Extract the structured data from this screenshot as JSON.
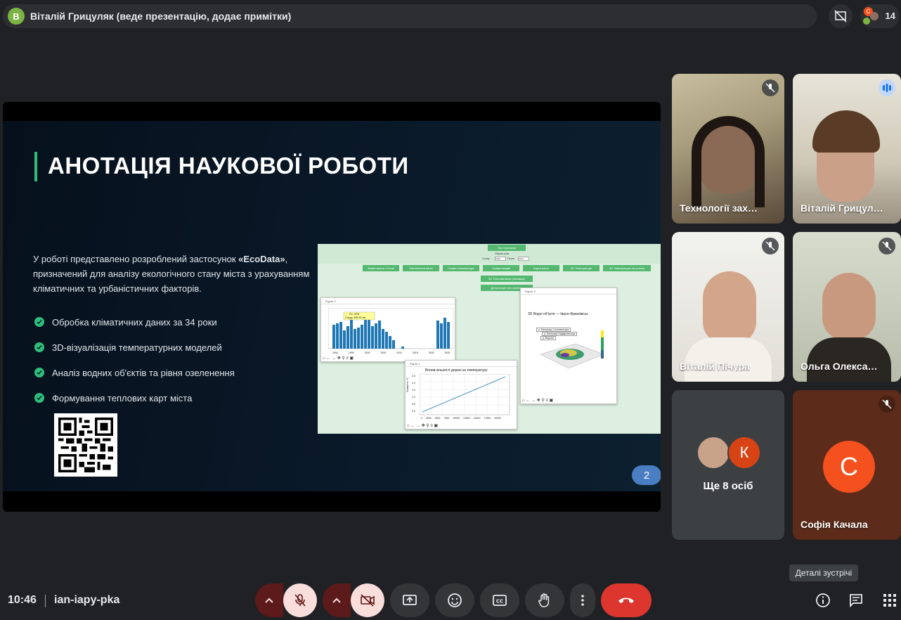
{
  "top_bar": {
    "presenter_initial": "В",
    "presenter_text": "Віталій Грицуляк (веде презентацію, додає примітки)",
    "participant_count": "14"
  },
  "slide": {
    "title": "АНОТАЦІЯ НАУКОВОЇ РОБОТИ",
    "intro_prefix": "У роботі представлено розроблений застосунок ",
    "intro_app": "«EcoData»",
    "intro_suffix": ", призначений для аналізу екологічного стану міста з урахуванням кліматичних та урбаністичних факторів.",
    "bullets": [
      "Обробка кліматичних даних за 34 роки",
      "3D-візуалізація температурних моделей",
      "Аналіз водних об'єктів та рівня озеленення",
      "Формування теплових карт міста"
    ],
    "page_number": "2",
    "app_screenshot": {
      "top_button": "Про програму",
      "period_label": "Обрати роки",
      "year_from_label": "З року:",
      "year_from": "1990",
      "year_to_label": "По рік:",
      "year_to": "2024",
      "menu_buttons": [
        "Завантажити з Excel",
        "Озеленення міста",
        "Графік температури",
        "Графік опадів",
        "Карта міста",
        "3D Температура",
        "3D Температура (по роках)"
      ],
      "heatmap_button": "3D Теплова мапа (анімація)",
      "details_button": "Детальніше про кожен...",
      "figure2_title": "Figure 2",
      "figure2_tooltip_1": "Рік: 2003",
      "figure2_tooltip_2": "Опади: 665.00 мм",
      "figure2_xticks": [
        "1990",
        "1995",
        "2000",
        "2005",
        "2010",
        "2015",
        "2020",
        "2025"
      ],
      "figure1_title": "Figure 1",
      "figure1_plot_title": "Вплив кількості дерев на температуру",
      "figure1_ylabel": "Зниження °C",
      "figure1_xticks": [
        "0",
        "2500",
        "5000",
        "7500",
        "10000",
        "12500",
        "15000",
        "17500",
        "20000"
      ],
      "figure1_yticks": [
        "2.5",
        "2.0",
        "1.5",
        "1.0",
        "0.5",
        "0.0"
      ],
      "figure3_title": "Figure 3",
      "figure3_plot_title": "3D Водні об'єкти — Івано-Франківськ",
      "figure3_labels": [
        "р. Бистриця Солотвинська",
        "р. Бистриця Надвірнянська",
        "р. Ворона"
      ]
    }
  },
  "participants": [
    {
      "name": "Технології зах…",
      "muted": true
    },
    {
      "name": "Віталій Грицул…",
      "muted": false,
      "speaking": true
    },
    {
      "name": "Віталій Пічура",
      "muted": true
    },
    {
      "name": "Ольга Олекса…",
      "muted": true
    },
    {
      "name": "Ще 8 осіб",
      "extra_initial": "К"
    },
    {
      "name": "Софія Качала",
      "initial": "С",
      "muted": true
    }
  ],
  "bottom_bar": {
    "time": "10:46",
    "meeting_code": "ian-iapy-pka",
    "tooltip": "Деталі зустрічі"
  },
  "colors": {
    "accent_green": "#2ebd7a",
    "end_call": "#dc362e",
    "muted_control_bg": "#f9dedc",
    "sofia_avatar": "#f4511e",
    "k_avatar": "#d84315"
  }
}
